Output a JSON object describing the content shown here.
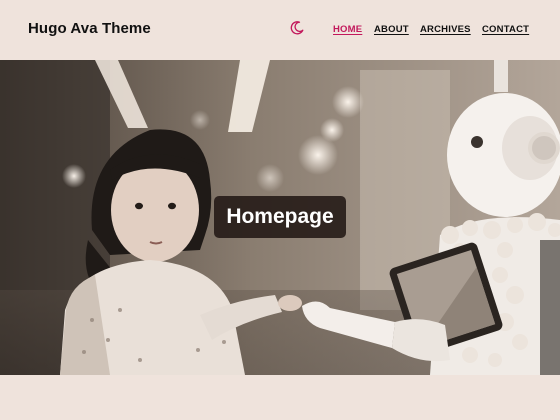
{
  "site": {
    "title": "Hugo Ava Theme"
  },
  "header": {
    "theme_toggle_icon": "moon-icon",
    "nav": [
      {
        "label": "HOME",
        "active": true
      },
      {
        "label": "ABOUT",
        "active": false
      },
      {
        "label": "ARCHIVES",
        "active": false
      },
      {
        "label": "CONTACT",
        "active": false
      }
    ]
  },
  "hero": {
    "title": "Homepage",
    "image_subject": "child-and-robot-photo"
  },
  "colors": {
    "background": "#efe3dc",
    "accent": "#c2185b",
    "text": "#111111",
    "title_box": "#221814"
  }
}
